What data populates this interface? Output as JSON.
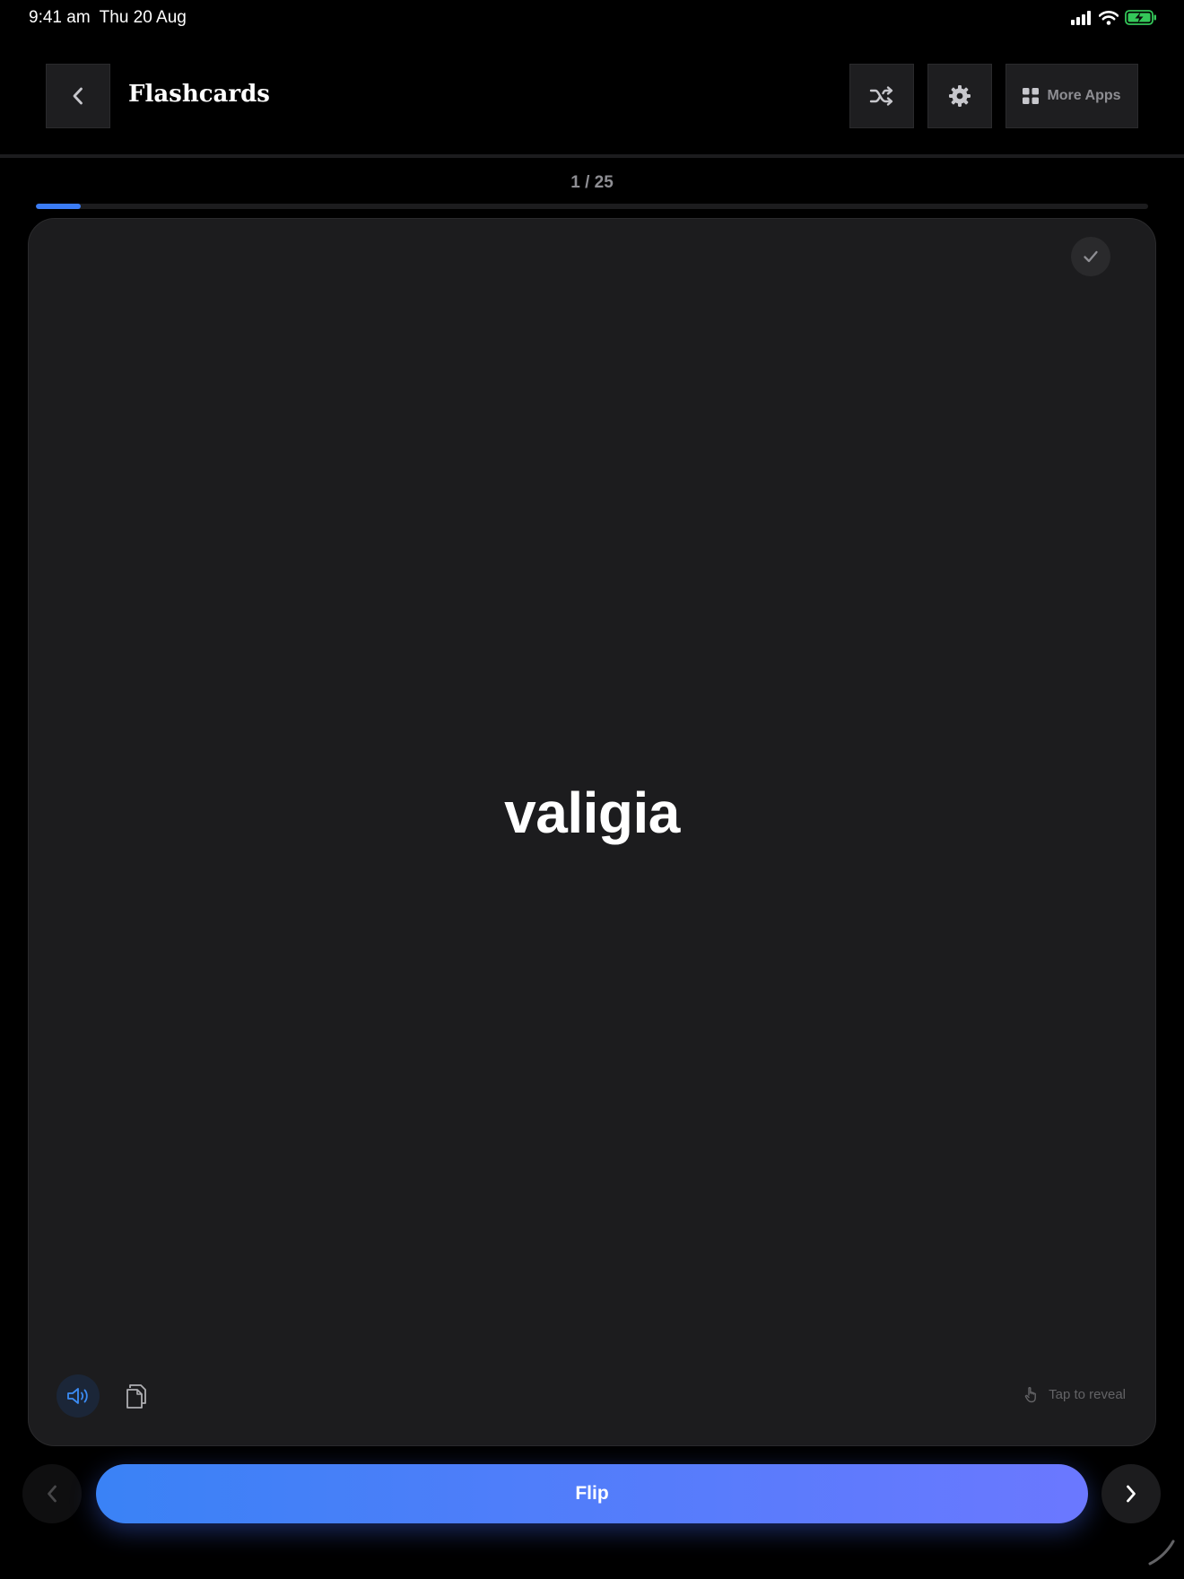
{
  "status_bar": {
    "time": "9:41 am",
    "date": "Thu 20 Aug",
    "icons": [
      "signal-icon",
      "wifi-icon",
      "battery-charging-icon"
    ],
    "battery_color": "#34c759"
  },
  "header": {
    "title": "Flashcards",
    "back_icon": "chevron-left-icon",
    "shuffle_icon": "shuffle-icon",
    "settings_icon": "gear-icon",
    "more_apps_label": "More Apps",
    "more_apps_icon": "grid-icon"
  },
  "progress": {
    "counter_text": "1 / 25",
    "current": 1,
    "total": 25,
    "fill_fraction": 0.04,
    "color": "#3b7cf5"
  },
  "card": {
    "word": "valigia",
    "check_icon": "checkmark-icon",
    "audio_icon": "speaker-icon",
    "copy_icon": "copy-icon",
    "hint_icon": "tap-hand-icon",
    "hint_text": "Tap to reveal"
  },
  "nav": {
    "prev_icon": "chevron-left-icon",
    "next_icon": "chevron-right-icon",
    "flip_label": "Flip",
    "flip_gradient": [
      "#3a82f6",
      "#6b78ff"
    ]
  }
}
